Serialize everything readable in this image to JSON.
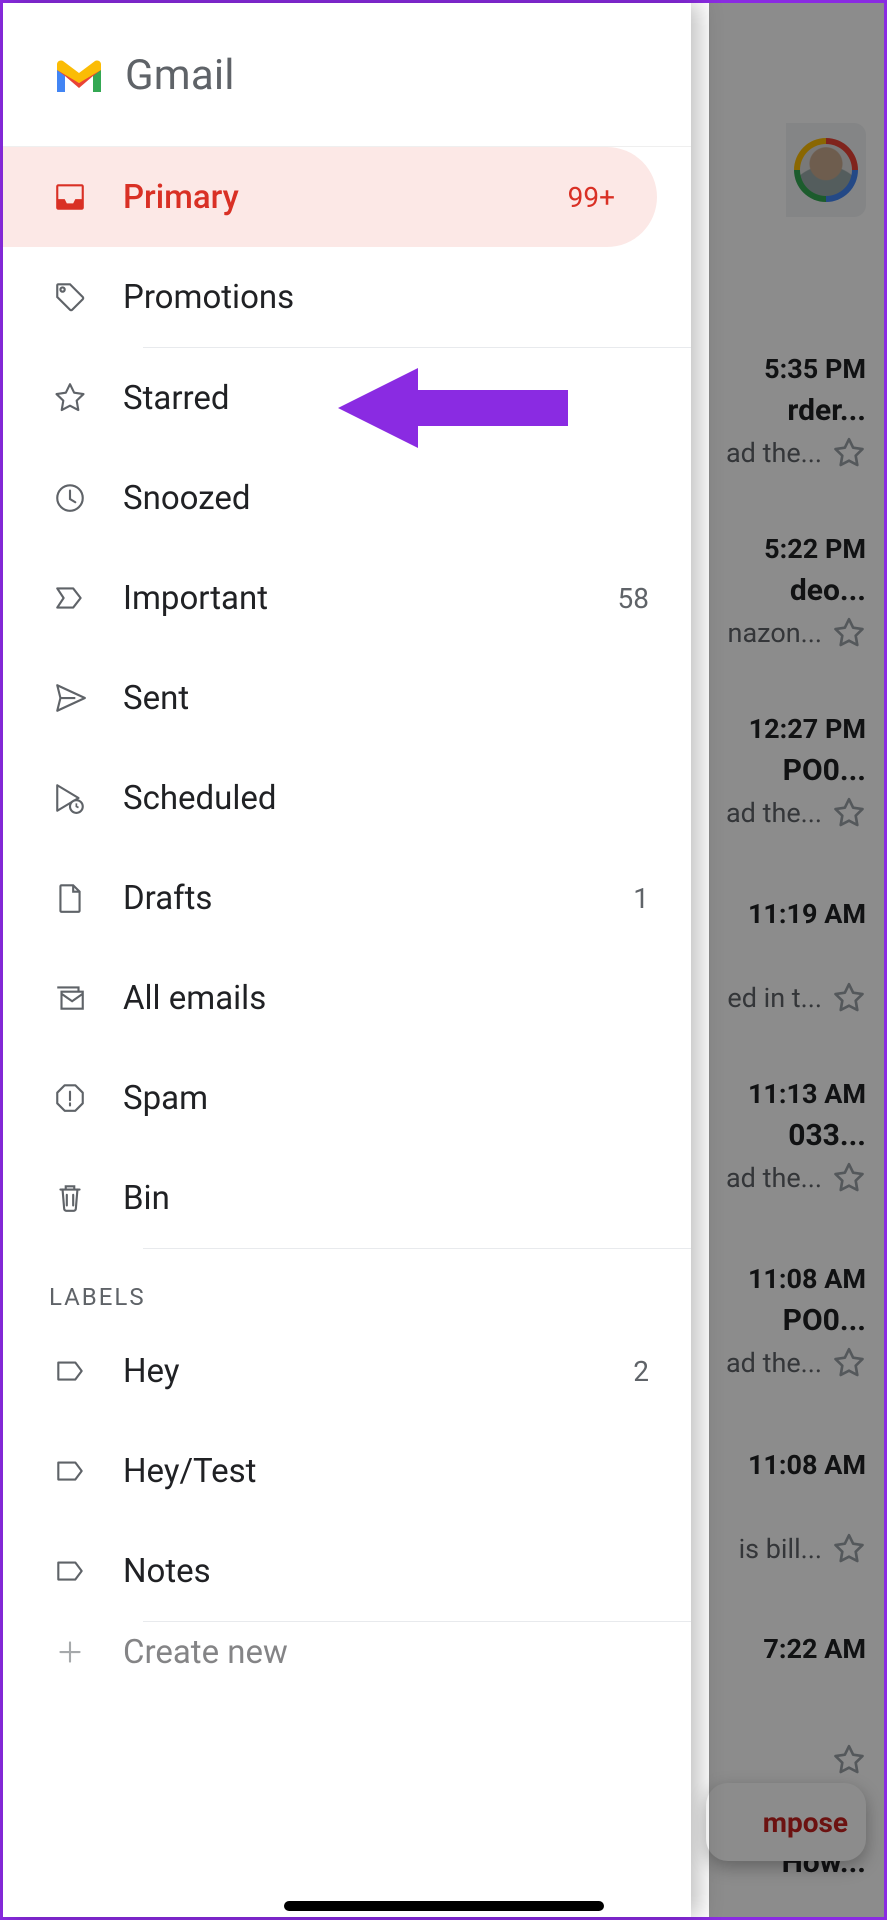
{
  "brand": {
    "name": "Gmail"
  },
  "drawer": {
    "categories": [
      {
        "id": "primary",
        "label": "Primary",
        "count": "99+",
        "selected": true
      },
      {
        "id": "promotions",
        "label": "Promotions",
        "count": "",
        "selected": false
      }
    ],
    "folders": [
      {
        "id": "starred",
        "label": "Starred",
        "count": ""
      },
      {
        "id": "snoozed",
        "label": "Snoozed",
        "count": ""
      },
      {
        "id": "important",
        "label": "Important",
        "count": "58"
      },
      {
        "id": "sent",
        "label": "Sent",
        "count": ""
      },
      {
        "id": "scheduled",
        "label": "Scheduled",
        "count": ""
      },
      {
        "id": "drafts",
        "label": "Drafts",
        "count": "1"
      },
      {
        "id": "allemails",
        "label": "All emails",
        "count": ""
      },
      {
        "id": "spam",
        "label": "Spam",
        "count": ""
      },
      {
        "id": "bin",
        "label": "Bin",
        "count": ""
      }
    ],
    "labels_title": "LABELS",
    "labels": [
      {
        "id": "hey",
        "label": "Hey",
        "count": "2"
      },
      {
        "id": "heytest",
        "label": "Hey/Test",
        "count": ""
      },
      {
        "id": "notes",
        "label": "Notes",
        "count": ""
      }
    ],
    "create_new": "Create new"
  },
  "compose": {
    "label": "mpose"
  },
  "inbox_peek": [
    {
      "time": "5:35 PM",
      "line1": "rder...",
      "line2": "ad the..."
    },
    {
      "time": "5:22 PM",
      "line1": "deo...",
      "line2": "nazon..."
    },
    {
      "time": "12:27 PM",
      "line1": " PO0...",
      "line2": "ad the..."
    },
    {
      "time": "11:19 AM",
      "line1": "",
      "line2": "ed in t..."
    },
    {
      "time": "11:13 AM",
      "line1": "033...",
      "line2": "ad the..."
    },
    {
      "time": "11:08 AM",
      "line1": "PO0...",
      "line2": "ad the..."
    },
    {
      "time": "11:08 AM",
      "line1": "",
      "line2": "is bill..."
    },
    {
      "time": "7:22 AM",
      "line1": "",
      "line2": ""
    },
    {
      "time": "",
      "line1": " How...",
      "line2": ""
    }
  ]
}
